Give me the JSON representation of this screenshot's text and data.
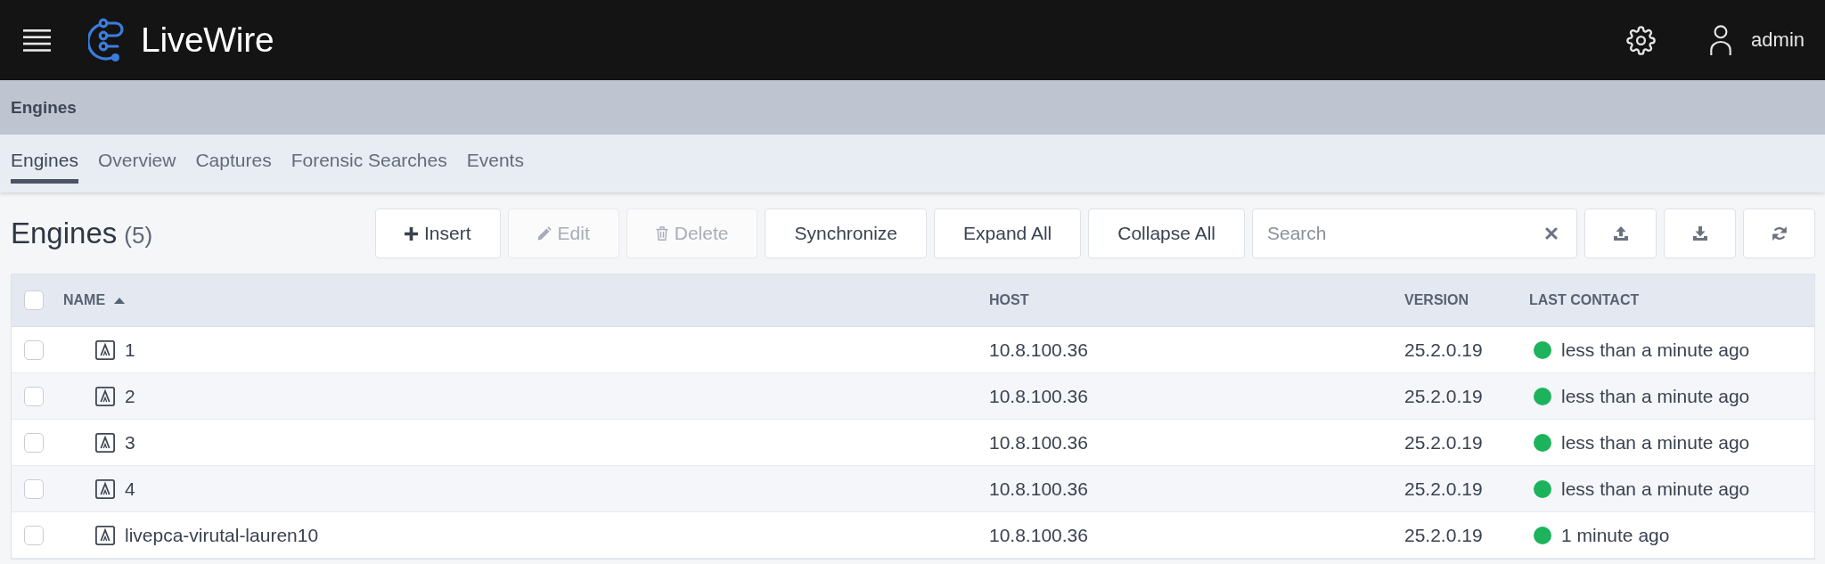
{
  "app": {
    "title": "LiveWire",
    "user": "admin"
  },
  "page_header": {
    "title": "Engines"
  },
  "tabs": [
    {
      "label": "Engines",
      "selected": true
    },
    {
      "label": "Overview",
      "selected": false
    },
    {
      "label": "Captures",
      "selected": false
    },
    {
      "label": "Forensic Searches",
      "selected": false
    },
    {
      "label": "Events",
      "selected": false
    }
  ],
  "toolbar": {
    "title": "Engines",
    "count": "(5)",
    "buttons": [
      {
        "label": "Insert",
        "disabled": false
      },
      {
        "label": "Edit",
        "disabled": true
      },
      {
        "label": "Delete",
        "disabled": true
      },
      {
        "label": "Synchronize",
        "disabled": false
      },
      {
        "label": "Expand All",
        "disabled": false
      },
      {
        "label": "Collapse All",
        "disabled": false
      }
    ],
    "search": {
      "placeholder": "Search"
    }
  },
  "table": {
    "select_all": {
      "checked": false
    },
    "columns": [
      {
        "label": "NAME",
        "sorted": true
      },
      {
        "label": "HOST",
        "sorted": false
      },
      {
        "label": "VERSION",
        "sorted": false
      },
      {
        "label": "LAST CONTACT",
        "sorted": false
      }
    ],
    "rows": [
      {
        "checked": false,
        "name": "1",
        "host": "10.8.100.36",
        "version": "25.2.0.19",
        "last_contact": "less than a minute ago",
        "color": "#1db35c"
      },
      {
        "checked": false,
        "name": "2",
        "host": "10.8.100.36",
        "version": "25.2.0.19",
        "last_contact": "less than a minute ago",
        "color": "#1db35c"
      },
      {
        "checked": false,
        "name": "3",
        "host": "10.8.100.36",
        "version": "25.2.0.19",
        "last_contact": "less than a minute ago",
        "color": "#1db35c"
      },
      {
        "checked": false,
        "name": "4",
        "host": "10.8.100.36",
        "version": "25.2.0.19",
        "last_contact": "less than a minute ago",
        "color": "#1db35c"
      },
      {
        "checked": false,
        "name": "livepca-virutal-lauren10",
        "host": "10.8.100.36",
        "version": "25.2.0.19",
        "last_contact": "1 minute ago",
        "color": "#1db35c"
      }
    ]
  }
}
